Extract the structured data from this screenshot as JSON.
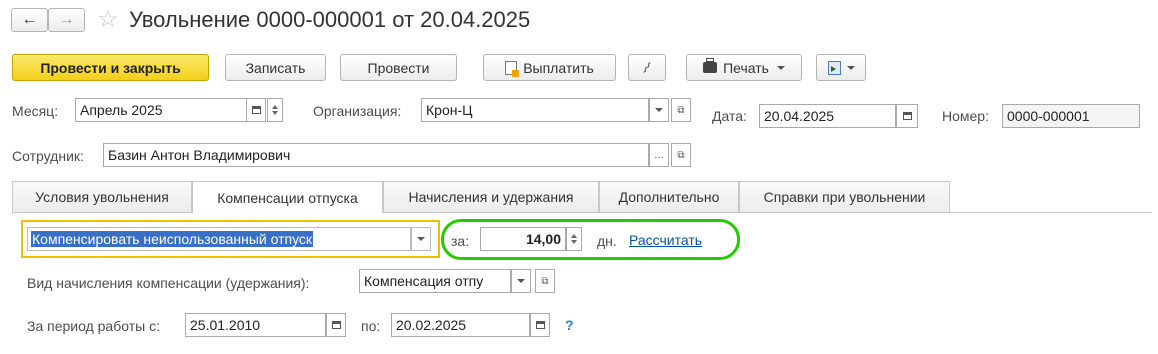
{
  "header": {
    "back_label": "←",
    "forward_label": "→",
    "star_icon": "star-icon",
    "title": "Увольнение 0000-000001 от 20.04.2025"
  },
  "toolbar": {
    "post_close_label": "Провести и закрыть",
    "save_label": "Записать",
    "post_label": "Провести",
    "pay_label": "Выплатить",
    "print_label": "Печать"
  },
  "form": {
    "month_label": "Месяц:",
    "month_value": "Апрель 2025",
    "org_label": "Организация:",
    "org_value": "Крон-Ц",
    "date_label": "Дата:",
    "date_value": "20.04.2025",
    "number_label": "Номер:",
    "number_value": "0000-000001",
    "employee_label": "Сотрудник:",
    "employee_value": "Базин Антон Владимирович"
  },
  "tabs": [
    {
      "label": "Условия увольнения"
    },
    {
      "label": "Компенсации отпуска"
    },
    {
      "label": "Начисления и удержания"
    },
    {
      "label": "Дополнительно"
    },
    {
      "label": "Справки при увольнении"
    }
  ],
  "compensation": {
    "mode_value": "Компенсировать неиспользованный отпуск",
    "za_label": "за:",
    "days_value": "14,00",
    "days_unit": "дн.",
    "calc_link": "Рассчитать",
    "type_label": "Вид начисления компенсации (удержания):",
    "type_value": "Компенсация отпу",
    "period_from_label": "За период работы с:",
    "period_from_value": "25.01.2010",
    "period_to_label": "по:",
    "period_to_value": "20.02.2025",
    "help_label": "?"
  },
  "colors": {
    "primary_button": "#f3cf1a",
    "highlight_ring": "#22cc00",
    "active_field_border": "#f0c000",
    "link": "#0055aa",
    "selection": "#3870c8"
  }
}
